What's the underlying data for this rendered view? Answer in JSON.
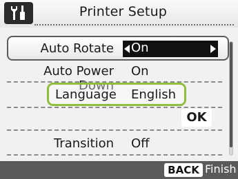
{
  "header": {
    "title": "Printer Setup",
    "icon": "tools-icon"
  },
  "settings": [
    {
      "label": "Auto Rotate",
      "value": "On"
    },
    {
      "label": "Auto Power Down",
      "value": "On"
    },
    {
      "label": "Language",
      "value": "English"
    },
    {
      "label": "Transition",
      "value": "Off"
    }
  ],
  "ok_label": "OK",
  "footer": {
    "back_key": "BACK",
    "finish_label": "Finish"
  },
  "colors": {
    "highlight_green": "#8fbe3f",
    "selector_bg": "#111111",
    "footer_bg": "#5a5a5a"
  }
}
